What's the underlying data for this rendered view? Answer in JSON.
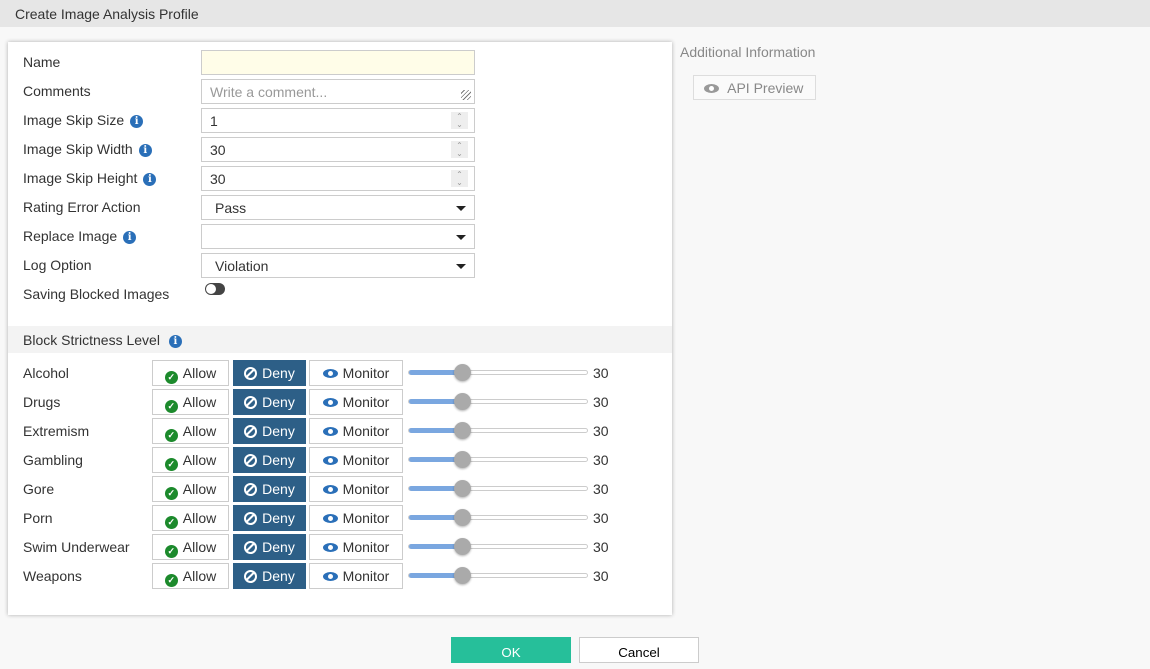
{
  "header": {
    "title": "Create Image Analysis Profile"
  },
  "form": {
    "name": {
      "label": "Name",
      "value": ""
    },
    "comments": {
      "label": "Comments",
      "placeholder": "Write a comment..."
    },
    "skip_size": {
      "label": "Image Skip Size",
      "value": "1"
    },
    "skip_width": {
      "label": "Image Skip Width",
      "value": "30"
    },
    "skip_height": {
      "label": "Image Skip Height",
      "value": "30"
    },
    "rating_error": {
      "label": "Rating Error Action",
      "value": "Pass"
    },
    "replace_image": {
      "label": "Replace Image",
      "value": ""
    },
    "log_option": {
      "label": "Log Option",
      "value": "Violation"
    },
    "saving_blocked": {
      "label": "Saving Blocked Images",
      "enabled": false
    }
  },
  "strictness": {
    "title": "Block Strictness Level",
    "allow_label": "Allow",
    "deny_label": "Deny",
    "monitor_label": "Monitor",
    "categories": [
      {
        "name": "Alcohol",
        "action": "Deny",
        "level": 30
      },
      {
        "name": "Drugs",
        "action": "Deny",
        "level": 30
      },
      {
        "name": "Extremism",
        "action": "Deny",
        "level": 30
      },
      {
        "name": "Gambling",
        "action": "Deny",
        "level": 30
      },
      {
        "name": "Gore",
        "action": "Deny",
        "level": 30
      },
      {
        "name": "Porn",
        "action": "Deny",
        "level": 30
      },
      {
        "name": "Swim Underwear",
        "action": "Deny",
        "level": 30
      },
      {
        "name": "Weapons",
        "action": "Deny",
        "level": 30
      }
    ],
    "max": 100
  },
  "side": {
    "title": "Additional Information",
    "api_preview": "API Preview"
  },
  "footer": {
    "ok": "OK",
    "cancel": "Cancel"
  },
  "colors": {
    "accent": "#26bf9a",
    "deny": "#2d5f87",
    "info": "#2a6fb8"
  }
}
